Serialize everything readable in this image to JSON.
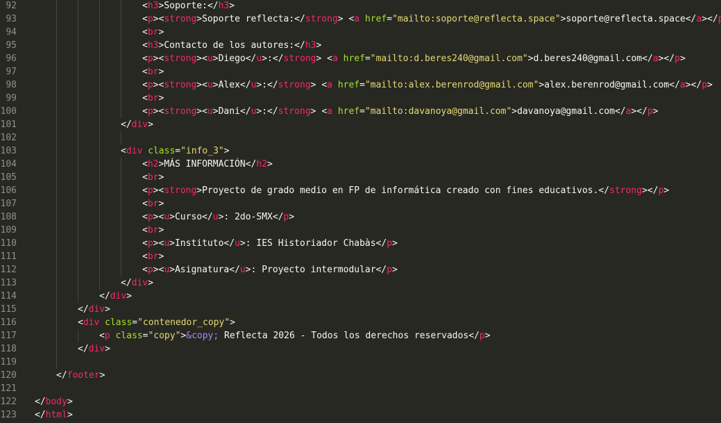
{
  "colors": {
    "background": "#272822",
    "line_number": "#8f908a",
    "punctuation": "#f8f8f2",
    "tag": "#f92672",
    "attribute": "#a6e22e",
    "string": "#e6db74",
    "entity": "#ae81ff",
    "text": "#f8f8f2"
  },
  "lines": [
    {
      "num": "92",
      "indent": 5,
      "tokens": [
        [
          "punct",
          "<"
        ],
        [
          "tag",
          "h3"
        ],
        [
          "punct",
          ">"
        ],
        [
          "text",
          "Soporte:"
        ],
        [
          "punct",
          "</"
        ],
        [
          "tag",
          "h3"
        ],
        [
          "punct",
          ">"
        ]
      ]
    },
    {
      "num": "93",
      "indent": 5,
      "tokens": [
        [
          "punct",
          "<"
        ],
        [
          "tag",
          "p"
        ],
        [
          "punct",
          "><"
        ],
        [
          "tag",
          "strong"
        ],
        [
          "punct",
          ">"
        ],
        [
          "text",
          "Soporte reflecta:"
        ],
        [
          "punct",
          "</"
        ],
        [
          "tag",
          "strong"
        ],
        [
          "punct",
          "> <"
        ],
        [
          "tag",
          "a"
        ],
        [
          "punct",
          " "
        ],
        [
          "attr",
          "href"
        ],
        [
          "punct",
          "="
        ],
        [
          "str",
          "\"mailto:soporte@reflecta.space\""
        ],
        [
          "punct",
          ">"
        ],
        [
          "text",
          "soporte@reflecta.space"
        ],
        [
          "punct",
          "</"
        ],
        [
          "tag",
          "a"
        ],
        [
          "punct",
          "></"
        ],
        [
          "tag",
          "p"
        ],
        [
          "punct",
          ">"
        ]
      ]
    },
    {
      "num": "94",
      "indent": 5,
      "tokens": [
        [
          "punct",
          "<"
        ],
        [
          "tag",
          "br"
        ],
        [
          "punct",
          ">"
        ]
      ]
    },
    {
      "num": "95",
      "indent": 5,
      "tokens": [
        [
          "punct",
          "<"
        ],
        [
          "tag",
          "h3"
        ],
        [
          "punct",
          ">"
        ],
        [
          "text",
          "Contacto de los autores:"
        ],
        [
          "punct",
          "</"
        ],
        [
          "tag",
          "h3"
        ],
        [
          "punct",
          ">"
        ]
      ]
    },
    {
      "num": "96",
      "indent": 5,
      "tokens": [
        [
          "punct",
          "<"
        ],
        [
          "tag",
          "p"
        ],
        [
          "punct",
          "><"
        ],
        [
          "tag",
          "strong"
        ],
        [
          "punct",
          "><"
        ],
        [
          "tag",
          "u"
        ],
        [
          "punct",
          ">"
        ],
        [
          "text",
          "Diego"
        ],
        [
          "punct",
          "</"
        ],
        [
          "tag",
          "u"
        ],
        [
          "punct",
          ">:</"
        ],
        [
          "tag",
          "strong"
        ],
        [
          "punct",
          "> <"
        ],
        [
          "tag",
          "a"
        ],
        [
          "punct",
          " "
        ],
        [
          "attr",
          "href"
        ],
        [
          "punct",
          "="
        ],
        [
          "str",
          "\"mailto:d.beres240@gmail.com\""
        ],
        [
          "punct",
          ">"
        ],
        [
          "text",
          "d.beres240@gmail.com"
        ],
        [
          "punct",
          "</"
        ],
        [
          "tag",
          "a"
        ],
        [
          "punct",
          "></"
        ],
        [
          "tag",
          "p"
        ],
        [
          "punct",
          ">"
        ]
      ]
    },
    {
      "num": "97",
      "indent": 5,
      "tokens": [
        [
          "punct",
          "<"
        ],
        [
          "tag",
          "br"
        ],
        [
          "punct",
          ">"
        ]
      ]
    },
    {
      "num": "98",
      "indent": 5,
      "tokens": [
        [
          "punct",
          "<"
        ],
        [
          "tag",
          "p"
        ],
        [
          "punct",
          "><"
        ],
        [
          "tag",
          "strong"
        ],
        [
          "punct",
          "><"
        ],
        [
          "tag",
          "u"
        ],
        [
          "punct",
          ">"
        ],
        [
          "text",
          "Alex"
        ],
        [
          "punct",
          "</"
        ],
        [
          "tag",
          "u"
        ],
        [
          "punct",
          ">:</"
        ],
        [
          "tag",
          "strong"
        ],
        [
          "punct",
          "> <"
        ],
        [
          "tag",
          "a"
        ],
        [
          "punct",
          " "
        ],
        [
          "attr",
          "href"
        ],
        [
          "punct",
          "="
        ],
        [
          "str",
          "\"mailto:alex.berenrod@gmail.com\""
        ],
        [
          "punct",
          ">"
        ],
        [
          "text",
          "alex.berenrod@gmail.com"
        ],
        [
          "punct",
          "</"
        ],
        [
          "tag",
          "a"
        ],
        [
          "punct",
          "></"
        ],
        [
          "tag",
          "p"
        ],
        [
          "punct",
          ">"
        ]
      ]
    },
    {
      "num": "99",
      "indent": 5,
      "tokens": [
        [
          "punct",
          "<"
        ],
        [
          "tag",
          "br"
        ],
        [
          "punct",
          ">"
        ]
      ]
    },
    {
      "num": "100",
      "indent": 5,
      "tokens": [
        [
          "punct",
          "<"
        ],
        [
          "tag",
          "p"
        ],
        [
          "punct",
          "><"
        ],
        [
          "tag",
          "strong"
        ],
        [
          "punct",
          "><"
        ],
        [
          "tag",
          "u"
        ],
        [
          "punct",
          ">"
        ],
        [
          "text",
          "Dani"
        ],
        [
          "punct",
          "</"
        ],
        [
          "tag",
          "u"
        ],
        [
          "punct",
          ">:</"
        ],
        [
          "tag",
          "strong"
        ],
        [
          "punct",
          "> <"
        ],
        [
          "tag",
          "a"
        ],
        [
          "punct",
          " "
        ],
        [
          "attr",
          "href"
        ],
        [
          "punct",
          "="
        ],
        [
          "str",
          "\"mailto:davanoya@gmail.com\""
        ],
        [
          "punct",
          ">"
        ],
        [
          "text",
          "davanoya@gmail.com"
        ],
        [
          "punct",
          "</"
        ],
        [
          "tag",
          "a"
        ],
        [
          "punct",
          "></"
        ],
        [
          "tag",
          "p"
        ],
        [
          "punct",
          ">"
        ]
      ]
    },
    {
      "num": "101",
      "indent": 4,
      "tokens": [
        [
          "punct",
          "</"
        ],
        [
          "tag",
          "div"
        ],
        [
          "punct",
          ">"
        ]
      ]
    },
    {
      "num": "102",
      "indent": 0,
      "tokens": []
    },
    {
      "num": "103",
      "indent": 4,
      "tokens": [
        [
          "punct",
          "<"
        ],
        [
          "tag",
          "div"
        ],
        [
          "punct",
          " "
        ],
        [
          "attr",
          "class"
        ],
        [
          "punct",
          "="
        ],
        [
          "str",
          "\"info_3\""
        ],
        [
          "punct",
          ">"
        ]
      ]
    },
    {
      "num": "104",
      "indent": 5,
      "tokens": [
        [
          "punct",
          "<"
        ],
        [
          "tag",
          "h2"
        ],
        [
          "punct",
          ">"
        ],
        [
          "text",
          "MÁS INFORMACIÓN"
        ],
        [
          "punct",
          "</"
        ],
        [
          "tag",
          "h2"
        ],
        [
          "punct",
          ">"
        ]
      ]
    },
    {
      "num": "105",
      "indent": 5,
      "tokens": [
        [
          "punct",
          "<"
        ],
        [
          "tag",
          "br"
        ],
        [
          "punct",
          ">"
        ]
      ]
    },
    {
      "num": "106",
      "indent": 5,
      "tokens": [
        [
          "punct",
          "<"
        ],
        [
          "tag",
          "p"
        ],
        [
          "punct",
          "><"
        ],
        [
          "tag",
          "strong"
        ],
        [
          "punct",
          ">"
        ],
        [
          "text",
          "Proyecto de grado medio en FP de informática creado con fines educativos."
        ],
        [
          "punct",
          "</"
        ],
        [
          "tag",
          "strong"
        ],
        [
          "punct",
          "></"
        ],
        [
          "tag",
          "p"
        ],
        [
          "punct",
          ">"
        ]
      ]
    },
    {
      "num": "107",
      "indent": 5,
      "tokens": [
        [
          "punct",
          "<"
        ],
        [
          "tag",
          "br"
        ],
        [
          "punct",
          ">"
        ]
      ]
    },
    {
      "num": "108",
      "indent": 5,
      "tokens": [
        [
          "punct",
          "<"
        ],
        [
          "tag",
          "p"
        ],
        [
          "punct",
          "><"
        ],
        [
          "tag",
          "u"
        ],
        [
          "punct",
          ">"
        ],
        [
          "text",
          "Curso"
        ],
        [
          "punct",
          "</"
        ],
        [
          "tag",
          "u"
        ],
        [
          "punct",
          ">"
        ],
        [
          "text",
          ": 2do-SMX"
        ],
        [
          "punct",
          "</"
        ],
        [
          "tag",
          "p"
        ],
        [
          "punct",
          ">"
        ]
      ]
    },
    {
      "num": "109",
      "indent": 5,
      "tokens": [
        [
          "punct",
          "<"
        ],
        [
          "tag",
          "br"
        ],
        [
          "punct",
          ">"
        ]
      ]
    },
    {
      "num": "110",
      "indent": 5,
      "tokens": [
        [
          "punct",
          "<"
        ],
        [
          "tag",
          "p"
        ],
        [
          "punct",
          "><"
        ],
        [
          "tag",
          "u"
        ],
        [
          "punct",
          ">"
        ],
        [
          "text",
          "Instituto"
        ],
        [
          "punct",
          "</"
        ],
        [
          "tag",
          "u"
        ],
        [
          "punct",
          ">"
        ],
        [
          "text",
          ": IES Historiador Chabàs"
        ],
        [
          "punct",
          "</"
        ],
        [
          "tag",
          "p"
        ],
        [
          "punct",
          ">"
        ]
      ]
    },
    {
      "num": "111",
      "indent": 5,
      "tokens": [
        [
          "punct",
          "<"
        ],
        [
          "tag",
          "br"
        ],
        [
          "punct",
          ">"
        ]
      ]
    },
    {
      "num": "112",
      "indent": 5,
      "tokens": [
        [
          "punct",
          "<"
        ],
        [
          "tag",
          "p"
        ],
        [
          "punct",
          "><"
        ],
        [
          "tag",
          "u"
        ],
        [
          "punct",
          ">"
        ],
        [
          "text",
          "Asignatura"
        ],
        [
          "punct",
          "</"
        ],
        [
          "tag",
          "u"
        ],
        [
          "punct",
          ">"
        ],
        [
          "text",
          ": Proyecto intermodular"
        ],
        [
          "punct",
          "</"
        ],
        [
          "tag",
          "p"
        ],
        [
          "punct",
          ">"
        ]
      ]
    },
    {
      "num": "113",
      "indent": 4,
      "tokens": [
        [
          "punct",
          "</"
        ],
        [
          "tag",
          "div"
        ],
        [
          "punct",
          ">"
        ]
      ]
    },
    {
      "num": "114",
      "indent": 3,
      "tokens": [
        [
          "punct",
          "</"
        ],
        [
          "tag",
          "div"
        ],
        [
          "punct",
          ">"
        ]
      ]
    },
    {
      "num": "115",
      "indent": 2,
      "tokens": [
        [
          "punct",
          "</"
        ],
        [
          "tag",
          "div"
        ],
        [
          "punct",
          ">"
        ]
      ]
    },
    {
      "num": "116",
      "indent": 2,
      "tokens": [
        [
          "punct",
          "<"
        ],
        [
          "tag",
          "div"
        ],
        [
          "punct",
          " "
        ],
        [
          "attr",
          "class"
        ],
        [
          "punct",
          "="
        ],
        [
          "str",
          "\"contenedor_copy\""
        ],
        [
          "punct",
          ">"
        ]
      ]
    },
    {
      "num": "117",
      "indent": 3,
      "tokens": [
        [
          "punct",
          "<"
        ],
        [
          "tag",
          "p"
        ],
        [
          "punct",
          " "
        ],
        [
          "attr",
          "class"
        ],
        [
          "punct",
          "="
        ],
        [
          "str",
          "\"copy\""
        ],
        [
          "punct",
          ">"
        ],
        [
          "ent",
          "&copy;"
        ],
        [
          "text",
          " Reflecta 2026 - Todos los derechos reservados"
        ],
        [
          "punct",
          "</"
        ],
        [
          "tag",
          "p"
        ],
        [
          "punct",
          ">"
        ]
      ]
    },
    {
      "num": "118",
      "indent": 2,
      "tokens": [
        [
          "punct",
          "</"
        ],
        [
          "tag",
          "div"
        ],
        [
          "punct",
          ">"
        ]
      ]
    },
    {
      "num": "119",
      "indent": 0,
      "tokens": []
    },
    {
      "num": "120",
      "indent": 1,
      "tokens": [
        [
          "punct",
          "</"
        ],
        [
          "tag",
          "footer"
        ],
        [
          "punct",
          ">"
        ]
      ]
    },
    {
      "num": "121",
      "indent": 0,
      "tokens": []
    },
    {
      "num": "122",
      "indent": 0,
      "tokens": [
        [
          "punct",
          "</"
        ],
        [
          "tag",
          "body"
        ],
        [
          "punct",
          ">"
        ]
      ]
    },
    {
      "num": "123",
      "indent": 0,
      "tokens": [
        [
          "punct",
          "</"
        ],
        [
          "tag",
          "html"
        ],
        [
          "punct",
          ">"
        ]
      ]
    }
  ]
}
